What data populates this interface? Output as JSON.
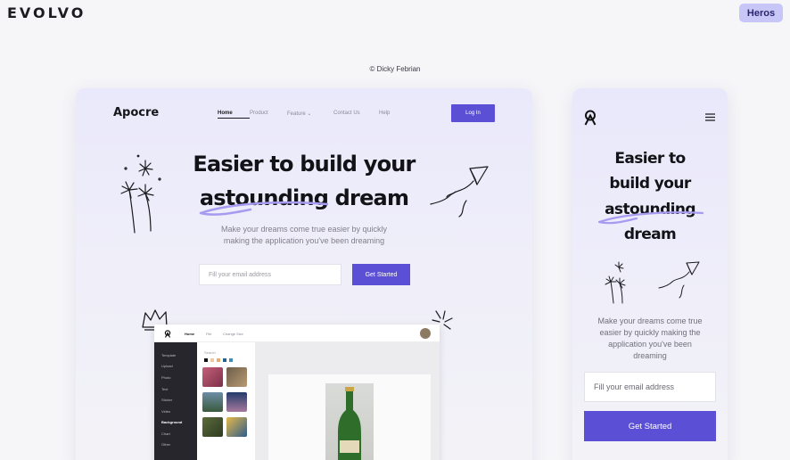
{
  "topbar": {
    "brand": "EVOLVO",
    "button": "Heros"
  },
  "credit": "© Dicky Febrian",
  "desktop": {
    "logo": "Apocre",
    "nav": [
      "Home",
      "Product",
      "Feature",
      "Contact Us",
      "Help"
    ],
    "login": "Log In",
    "headline_1": "Easier to build your",
    "headline_2": "astounding dream",
    "sub_1": "Make your dreams come true easier by quickly",
    "sub_2": "making the application you've been dreaming",
    "email_placeholder": "Fill your email address",
    "cta": "Get Started",
    "app": {
      "menu": [
        "Home",
        "File",
        "Change Size"
      ],
      "sidebar": [
        "Template",
        "Upload",
        "Photo",
        "Text",
        "Sticker",
        "Video",
        "Background",
        "Chart",
        "Other"
      ],
      "search": "Search"
    }
  },
  "mobile": {
    "headline": [
      "Easier to",
      "build your",
      "astounding",
      "dream"
    ],
    "sub": [
      "Make your dreams come true",
      "easier by quickly making the",
      "application you've been",
      "dreaming"
    ],
    "email_placeholder": "Fill your email address",
    "cta": "Get Started"
  },
  "colors": {
    "accent": "#5b4fd6",
    "heros_bg": "#c7c6f6",
    "brand_dot": "#e23a4b"
  },
  "icons": [
    "fireworks-icon",
    "paper-plane-icon",
    "crown-icon",
    "sparkle-icon",
    "hamburger-menu-icon",
    "apocre-logo-icon",
    "chevron-down-icon"
  ]
}
